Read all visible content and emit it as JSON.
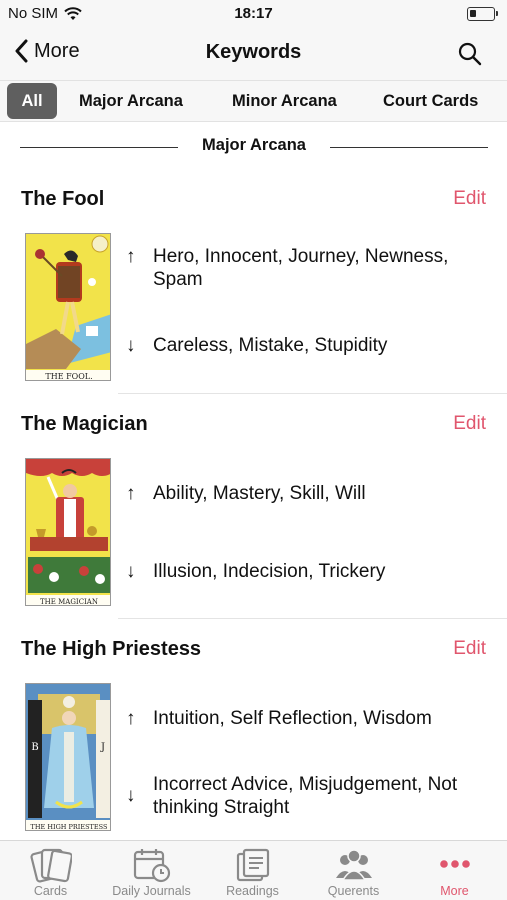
{
  "status_bar": {
    "carrier": "No SIM",
    "time": "18:17",
    "battery_level": 0.25
  },
  "nav": {
    "back_label": "More",
    "title": "Keywords"
  },
  "segments": [
    {
      "label": "All",
      "active": true
    },
    {
      "label": "Major Arcana",
      "active": false
    },
    {
      "label": "Minor Arcana",
      "active": false
    },
    {
      "label": "Court Cards",
      "active": false
    }
  ],
  "section": {
    "title": "Major Arcana"
  },
  "cards": [
    {
      "name": "The Fool",
      "edit_label": "Edit",
      "image_caption": "THE FOOL.",
      "upright": "Hero, Innocent, Journey, Newness, Spam",
      "reversed": "Careless, Mistake, Stupidity"
    },
    {
      "name": "The Magician",
      "edit_label": "Edit",
      "image_caption": "THE MAGICIAN",
      "upright": "Ability, Mastery, Skill, Will",
      "reversed": "Illusion, Indecision, Trickery"
    },
    {
      "name": "The High Priestess",
      "edit_label": "Edit",
      "image_caption": "THE HIGH PRIESTESS",
      "upright": "Intuition, Self Reflection, Wisdom",
      "reversed": "Incorrect Advice, Misjudgement, Not thinking Straight"
    }
  ],
  "tabs": [
    {
      "label": "Cards",
      "icon": "cards-icon",
      "active": false
    },
    {
      "label": "Daily Journals",
      "icon": "calendar-clock-icon",
      "active": false
    },
    {
      "label": "Readings",
      "icon": "readings-icon",
      "active": false
    },
    {
      "label": "Querents",
      "icon": "people-icon",
      "active": false
    },
    {
      "label": "More",
      "icon": "more-dots-icon",
      "active": true
    }
  ],
  "colors": {
    "accent": "#e0566d",
    "segment_active": "#5f5f5f",
    "bar_background": "#f7f7f7",
    "inactive_tab": "#8a8a8a"
  },
  "arrows": {
    "up": "↑",
    "down": "↓"
  }
}
